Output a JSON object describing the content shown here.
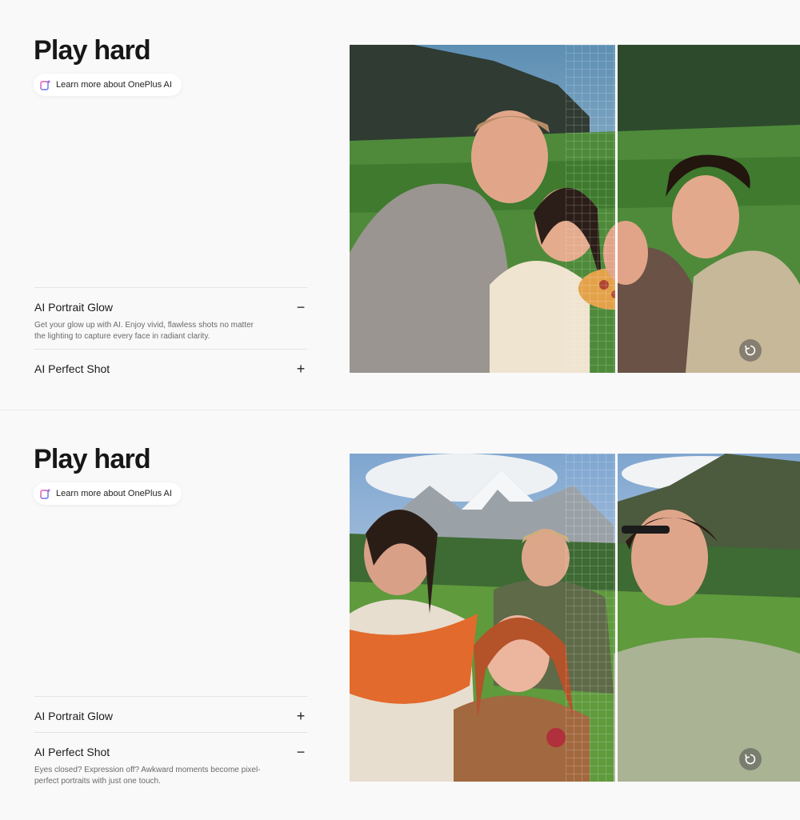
{
  "sections": [
    {
      "title": "Play hard",
      "learn_more": "Learn more about OnePlus AI",
      "items": [
        {
          "label": "AI Portrait Glow",
          "toggle": "−",
          "description": "Get your glow up with AI. Enjoy vivid, flawless shots no matter the lighting to capture every face in radiant clarity."
        },
        {
          "label": "AI Perfect Shot",
          "toggle": "+"
        }
      ]
    },
    {
      "title": "Play hard",
      "learn_more": "Learn more about OnePlus AI",
      "items": [
        {
          "label": "AI Portrait Glow",
          "toggle": "+"
        },
        {
          "label": "AI Perfect Shot",
          "toggle": "−",
          "description": "Eyes closed? Expression off? Awkward moments become pixel-perfect portraits with just one touch."
        }
      ]
    }
  ],
  "icons": {
    "ai": "ai-sparkle-icon",
    "replay": "replay-icon"
  },
  "colors": {
    "background": "#f9f9f9",
    "text": "#1b1b1b",
    "muted": "#6a6a6a",
    "ai_gradient_start": "#ff4fa3",
    "ai_gradient_end": "#3b7bff"
  }
}
